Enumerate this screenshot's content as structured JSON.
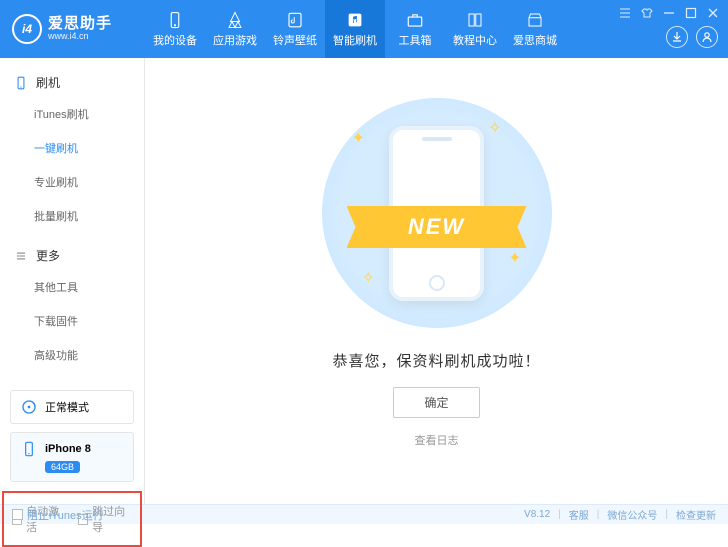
{
  "header": {
    "logo_text": "爱思助手",
    "logo_url": "www.i4.cn",
    "logo_badge": "i4",
    "nav": [
      {
        "label": "我的设备",
        "icon": "device"
      },
      {
        "label": "应用游戏",
        "icon": "apps"
      },
      {
        "label": "铃声壁纸",
        "icon": "music"
      },
      {
        "label": "智能刷机",
        "icon": "flash",
        "active": true
      },
      {
        "label": "工具箱",
        "icon": "toolbox"
      },
      {
        "label": "教程中心",
        "icon": "book"
      },
      {
        "label": "爱思商城",
        "icon": "store"
      }
    ]
  },
  "sidebar": {
    "sections": [
      {
        "title": "刷机",
        "items": [
          "iTunes刷机",
          "一键刷机",
          "专业刷机",
          "批量刷机"
        ],
        "active_index": 1
      },
      {
        "title": "更多",
        "items": [
          "其他工具",
          "下载固件",
          "高级功能"
        ],
        "active_index": -1
      }
    ],
    "mode": {
      "label": "正常模式"
    },
    "device": {
      "name": "iPhone 8",
      "storage": "64GB"
    },
    "options": {
      "auto_activate": "自动激活",
      "skip_guide": "跳过向导"
    }
  },
  "main": {
    "ribbon": "NEW",
    "success": "恭喜您，保资料刷机成功啦！",
    "ok": "确定",
    "log_link": "查看日志"
  },
  "footer": {
    "block_itunes": "阻止iTunes运行",
    "version": "V8.12",
    "support": "客服",
    "wechat": "微信公众号",
    "update": "检查更新"
  }
}
